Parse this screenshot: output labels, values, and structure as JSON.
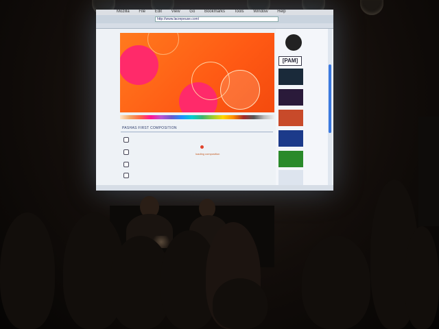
{
  "browser": {
    "menu": [
      "Mozilla",
      "File",
      "Edit",
      "View",
      "Go",
      "Bookmarks",
      "Tools",
      "Window",
      "Help"
    ],
    "url": "http://www.lacrepeuse.com/"
  },
  "page": {
    "composition_title": "PASHAS FIRST COMPOSITION",
    "loading_label": "loading composition",
    "sidebar_logo": "[PAM]"
  },
  "colors": {
    "artwork_orange": "#ff6a1a",
    "accent_pink": "#ff2a6a",
    "scroll_blue": "#3a78e0"
  }
}
